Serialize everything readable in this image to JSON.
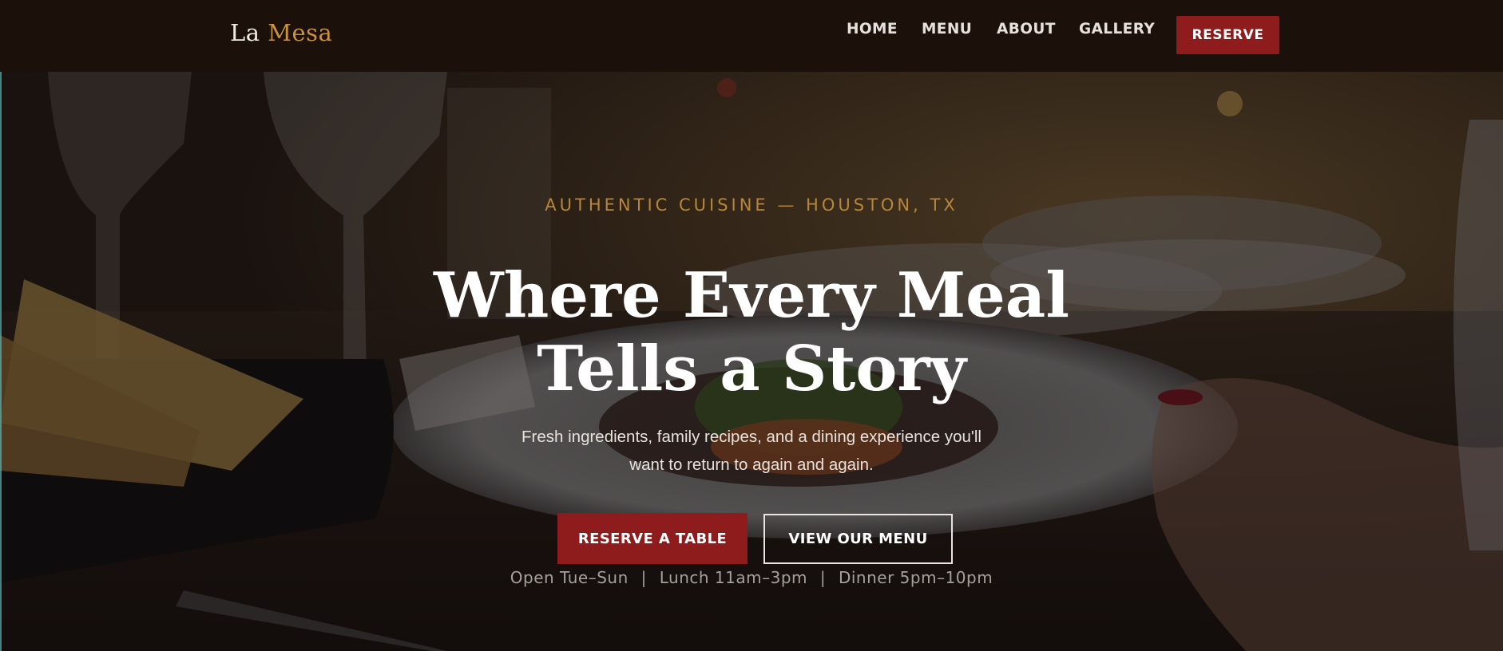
{
  "nav": {
    "brand_first": "La",
    "brand_second": "Mesa",
    "links": [
      "HOME",
      "MENU",
      "ABOUT",
      "GALLERY"
    ],
    "reserve_label": "RESERVE"
  },
  "hero": {
    "eyebrow": "AUTHENTIC CUISINE — HOUSTON, TX",
    "headline_line1": "Where Every Meal",
    "headline_line2": "Tells a Story",
    "subtext_line1": "Fresh ingredients, family recipes, and a dining experience you'll",
    "subtext_line2": "want to return to again and again.",
    "primary_cta": "RESERVE A TABLE",
    "secondary_cta": "VIEW OUR MENU",
    "hours": [
      "Open Tue–Sun",
      "Lunch 11am–3pm",
      "Dinner 5pm–10pm"
    ],
    "hours_separator": "|"
  },
  "colors": {
    "nav_bg": "#1b110a",
    "accent_gold": "#c8923e",
    "accent_red": "#8f1c1d",
    "text_light": "#e6e1db"
  }
}
